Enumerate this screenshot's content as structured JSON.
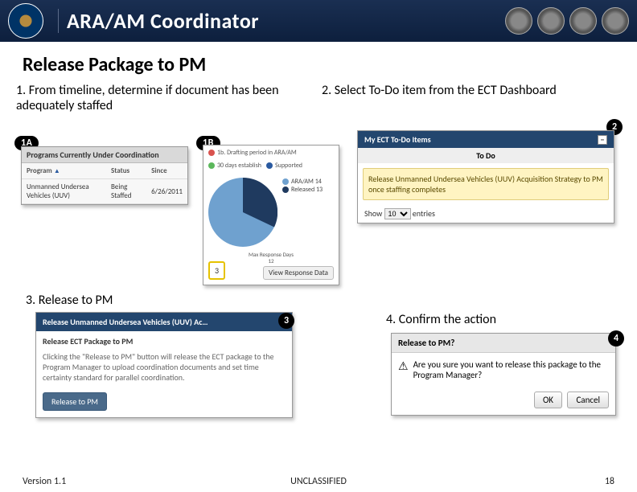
{
  "header": {
    "title": "ARA/AM Coordinator"
  },
  "section_title": "Release Package to PM",
  "steps": {
    "one": "1.  From timeline, determine if document has been adequately staffed",
    "two": "2.  Select To-Do item from the ECT Dashboard",
    "three": "3.  Release to PM",
    "four": "4.  Confirm the action"
  },
  "badges": {
    "oneA": "1A",
    "oneB": "1B",
    "two": "2",
    "three": "3",
    "four": "4"
  },
  "panel_1a": {
    "title": "Programs Currently Under Coordination",
    "cols": {
      "program": "Program",
      "status": "Status",
      "since": "Since"
    },
    "row": {
      "program": "Unmanned Undersea Vehicles (UUV)",
      "status": "Being Staffed",
      "since": "6/26/2011"
    },
    "sort_icon": "▲"
  },
  "panel_1b": {
    "legend_top1": "1b. Drafting period in ARA/AM",
    "legend_top2": "30 days establish",
    "legend_top3": "Supported",
    "legend_side1_label": "ARA/AM",
    "legend_side1_value": "14",
    "legend_side2_label": "Released",
    "legend_side2_value": "13",
    "bottom_label1": "Max Response Days",
    "bottom_label2": "12",
    "yellow_value": "3",
    "button": "View Response Data"
  },
  "panel_2": {
    "title": "My ECT To-Do Items",
    "subhead": "To Do",
    "item": "Release Unmanned Undersea Vehicles (UUV) Acquisition Strategy to PM once staffing completes",
    "foot_prefix": "Show",
    "foot_value": "10",
    "foot_suffix": "entries",
    "minus": "−"
  },
  "panel_3": {
    "title": "Release Unmanned Undersea Vehicles (UUV) Ac…",
    "subtitle": "Release ECT Package to PM",
    "body": "Clicking the \"Release to PM\" button will release the ECT package to the Program Manager to upload coordination documents and set time certainty standard for parallel coordination.",
    "button": "Release to PM"
  },
  "panel_4": {
    "title": "Release to PM?",
    "icon": "⚠",
    "body": "Are you sure you want to release this package to the Program Manager?",
    "ok": "OK",
    "cancel": "Cancel"
  },
  "footer": {
    "version": "Version 1.1",
    "class": "UNCLASSIFIED",
    "page": "18"
  },
  "chart_data": {
    "type": "pie",
    "title": "",
    "series": [
      {
        "name": "ARA/AM",
        "value": 14,
        "color": "#6fa1cf"
      },
      {
        "name": "Released",
        "value": 13,
        "color": "#1f3a5f"
      }
    ]
  }
}
